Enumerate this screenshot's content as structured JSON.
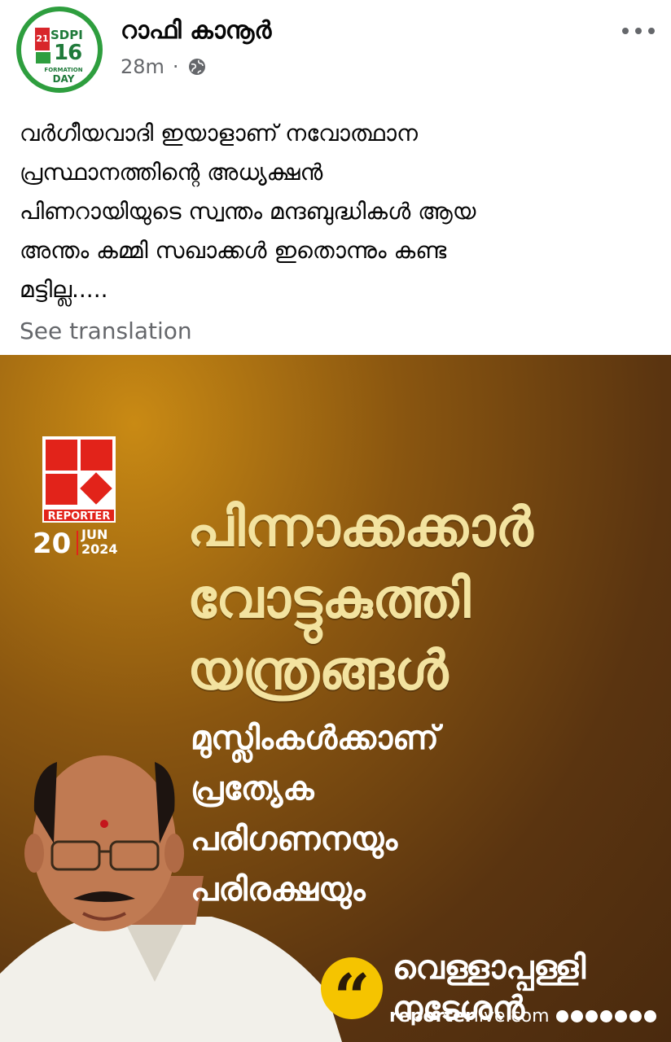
{
  "post": {
    "author": "റാഫി കാനൂർ",
    "time": "28m",
    "separator": "·",
    "body": "വർഗീയവാദി ഇയാളാണ് നവോത്ഥാന\nപ്രസ്ഥാനത്തിന്റെ അധ്യക്ഷൻ\nപിണറായിയുടെ സ്വന്തം മന്ദബുദ്ധികൾ ആയ\nഅന്തം കമ്മി സഖാക്കൾ ഇതൊന്നും കണ്ട\nമട്ടില്ല.....",
    "see_translation": "See translation"
  },
  "avatar": {
    "badge_number": "21",
    "party": "SDPI",
    "years": "16",
    "formation": "FORMATION",
    "day": "DAY"
  },
  "image": {
    "logo_label": "REPORTER",
    "date_day": "20",
    "date_month": "JUN",
    "date_year": "2024",
    "headline": [
      "പിന്നാക്കക്കാർ",
      "വോട്ടുകുത്തി",
      "യന്ത്രങ്ങൾ"
    ],
    "subline": [
      "മുസ്ലിംകൾക്കാണ്",
      "പ്രത്യേക",
      "പരിഗണനയും",
      "പരിരക്ഷയും"
    ],
    "quote_glyph": "“",
    "speaker": [
      "വെള്ളാപ്പള്ളി",
      "നടേശൻ"
    ],
    "site_bold": "reporter",
    "site_rest": "live.com"
  },
  "colors": {
    "avatar_ring": "#2e9e3e",
    "headline": "#f3e3a0",
    "logo_red": "#e2231a",
    "quote_yellow": "#f5c400"
  },
  "icons": [
    "globe-icon",
    "more-options-icon",
    "quote-icon"
  ]
}
